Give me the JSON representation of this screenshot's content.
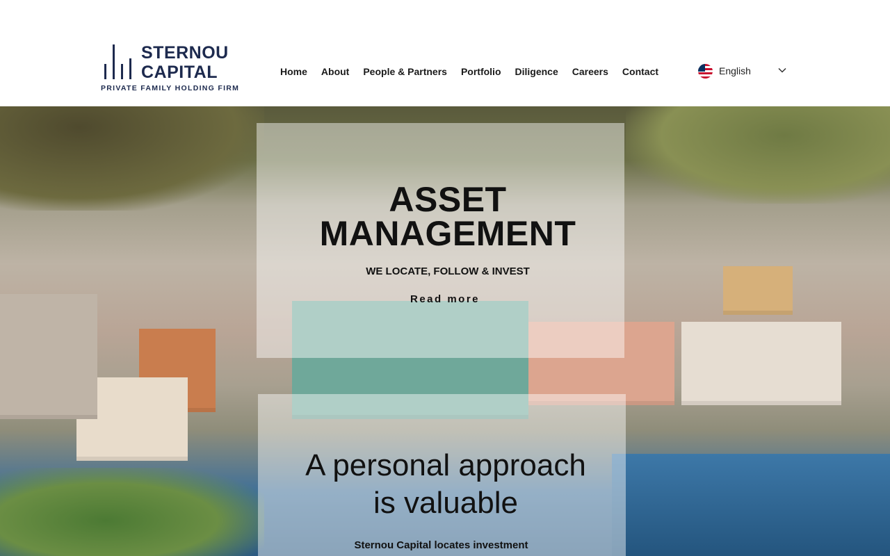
{
  "brand": {
    "name_line1": "STERNOU",
    "name_line2": "CAPITAL",
    "tagline": "PRIVATE FAMILY HOLDING FIRM",
    "color": "#1d2a4e"
  },
  "nav": {
    "items": [
      {
        "label": "Home"
      },
      {
        "label": "About"
      },
      {
        "label": "People & Partners"
      },
      {
        "label": "Portfolio"
      },
      {
        "label": "Diligence"
      },
      {
        "label": "Careers"
      },
      {
        "label": "Contact"
      }
    ]
  },
  "language": {
    "selected": "English",
    "flag_icon": "us-flag-icon"
  },
  "hero": {
    "title_line1": "ASSET",
    "title_line2": "MANAGEMENT",
    "subtitle": "WE LOCATE, FOLLOW & INVEST",
    "read_more": "Read more"
  },
  "section2": {
    "title_line1": "A personal approach",
    "title_line2": "is valuable",
    "body": "Sternou Capital locates investment"
  }
}
